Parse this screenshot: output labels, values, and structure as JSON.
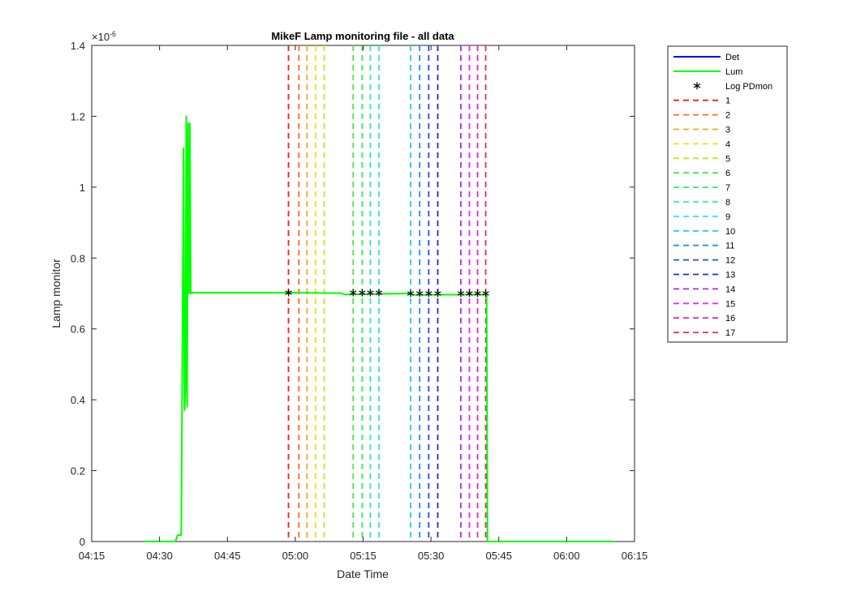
{
  "chart_data": {
    "type": "line",
    "title": "MikeF Lamp monitoring file - all data",
    "xlabel": "Date Time",
    "ylabel": "Lamp monitor",
    "y_exponent_label": "×10",
    "y_exponent_power": "-6",
    "x_ticks": [
      "04:15",
      "04:30",
      "04:45",
      "05:00",
      "05:15",
      "05:30",
      "05:45",
      "06:00",
      "06:15"
    ],
    "x_tick_minutes": [
      255,
      270,
      285,
      300,
      315,
      330,
      345,
      360,
      375
    ],
    "xlim_minutes": [
      255,
      375
    ],
    "y_ticks": [
      "0",
      "0.2",
      "0.4",
      "0.6",
      "0.8",
      "1",
      "1.2",
      "1.4"
    ],
    "y_tick_values": [
      0,
      0.2,
      0.4,
      0.6,
      0.8,
      1.0,
      1.2,
      1.4
    ],
    "ylim": [
      0,
      1.4
    ],
    "y_units_scale": 1e-06,
    "series": [
      {
        "name": "Det",
        "color": "#0000ff",
        "style": "solid",
        "x_minutes": [],
        "values": []
      },
      {
        "name": "Lum",
        "color": "#00ff00",
        "style": "solid",
        "x_minutes": [
          266.5,
          273.5,
          274.0,
          274.8,
          275.3,
          275.5,
          275.7,
          275.9,
          276.1,
          276.3,
          276.5,
          276.7,
          276.9,
          277.1,
          277.3,
          300,
          310,
          311,
          325,
          326,
          342.3,
          342.5,
          344,
          370.5
        ],
        "values": [
          0,
          0,
          0.018,
          0.018,
          1.11,
          0.37,
          0.42,
          1.2,
          0.38,
          1.18,
          0.7,
          1.18,
          0.7,
          0.7,
          0.702,
          0.702,
          0.701,
          0.697,
          0.7,
          0.696,
          0.697,
          0.0,
          0.0,
          0.0
        ]
      },
      {
        "name": "Log PDmon",
        "color": "#000000",
        "style": "marker-star",
        "x_minutes": [
          298.5,
          312.8,
          314.8,
          316.6,
          318.5,
          325.5,
          327.5,
          329.5,
          331.5,
          336.6,
          338.5,
          340.3,
          342.1
        ],
        "values": [
          0.702,
          0.702,
          0.702,
          0.702,
          0.702,
          0.7,
          0.7,
          0.7,
          0.7,
          0.7,
          0.7,
          0.7,
          0.7
        ]
      }
    ],
    "vertical_lines": [
      {
        "name": "1",
        "x_minute": 298.5,
        "color": "#ff1a1a"
      },
      {
        "name": "2",
        "x_minute": 300.8,
        "color": "#ff6a1a"
      },
      {
        "name": "3",
        "x_minute": 302.6,
        "color": "#ffa21a"
      },
      {
        "name": "4",
        "x_minute": 304.5,
        "color": "#e6e61a"
      },
      {
        "name": "5",
        "x_minute": 306.4,
        "color": "#b4ee1a"
      },
      {
        "name": "6",
        "x_minute": 312.8,
        "color": "#3fee3f"
      },
      {
        "name": "7",
        "x_minute": 314.8,
        "color": "#2aee6a"
      },
      {
        "name": "8",
        "x_minute": 316.6,
        "color": "#2aeeaa"
      },
      {
        "name": "9",
        "x_minute": 318.5,
        "color": "#2ae6e6"
      },
      {
        "name": "10",
        "x_minute": 325.5,
        "color": "#2ac8ee"
      },
      {
        "name": "11",
        "x_minute": 327.5,
        "color": "#2a8aee"
      },
      {
        "name": "12",
        "x_minute": 329.5,
        "color": "#2a4aee"
      },
      {
        "name": "13",
        "x_minute": 331.5,
        "color": "#2a2acc"
      },
      {
        "name": "14",
        "x_minute": 336.6,
        "color": "#aa2aee"
      },
      {
        "name": "15",
        "x_minute": 338.5,
        "color": "#ee2aee"
      },
      {
        "name": "16",
        "x_minute": 340.3,
        "color": "#ee2aaa"
      },
      {
        "name": "17",
        "x_minute": 342.1,
        "color": "#ee2a6a"
      }
    ],
    "legend_placement": "outside-right-top",
    "grid": false
  }
}
